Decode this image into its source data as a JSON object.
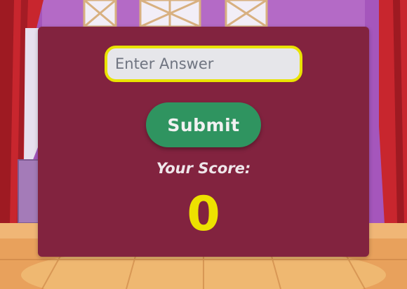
{
  "answer_input": {
    "placeholder": "Enter Answer",
    "value": ""
  },
  "submit_label": "Submit",
  "score": {
    "label": "Your Score:",
    "value": "0"
  },
  "colors": {
    "panel": "#82233f",
    "input_border": "#e9e300",
    "submit_button": "#2f9460",
    "score_value": "#ede100"
  }
}
